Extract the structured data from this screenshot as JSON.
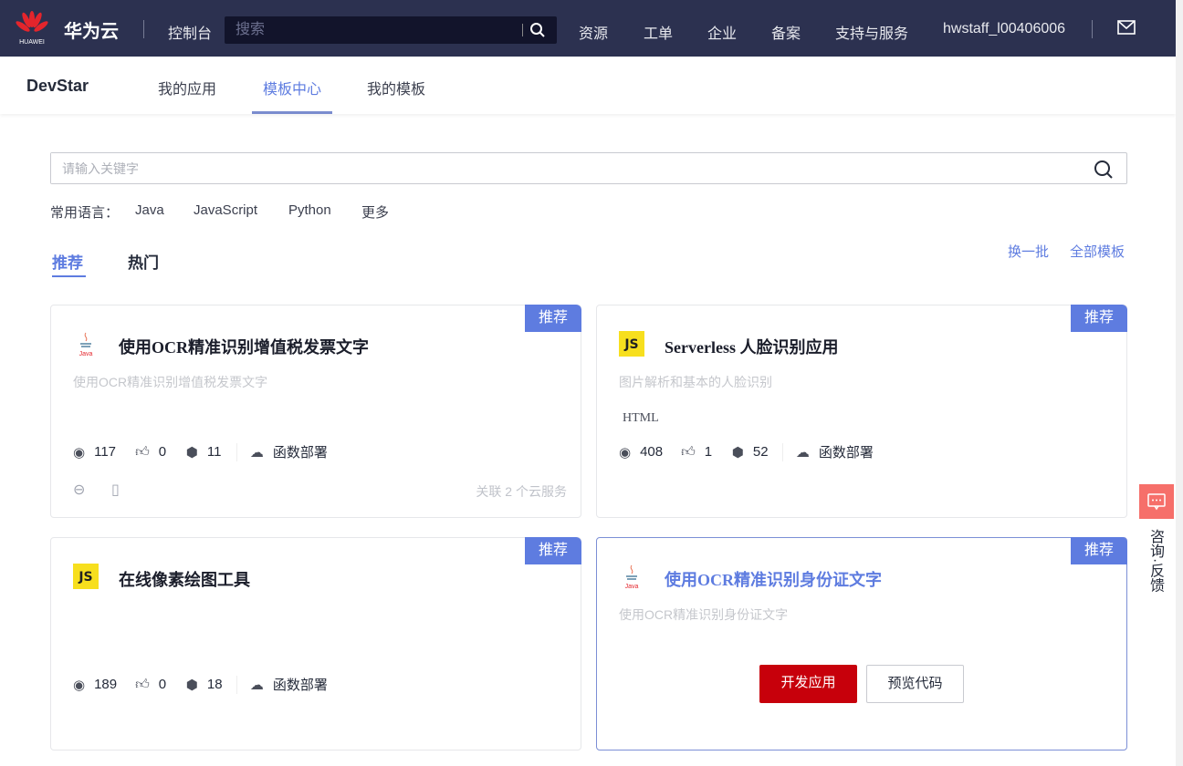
{
  "header": {
    "logo_text": "HUAWEI",
    "brand": "华为云",
    "console": "控制台",
    "search_placeholder": "搜索",
    "nav": [
      "资源",
      "工单",
      "企业",
      "备案",
      "支持与服务"
    ],
    "user": "hwstaff_l00406006"
  },
  "subnav": {
    "title": "DevStar",
    "items": [
      "我的应用",
      "模板中心",
      "我的模板"
    ],
    "active": 1
  },
  "search": {
    "placeholder": "请输入关键字"
  },
  "languages": {
    "label": "常用语言：",
    "items": [
      "Java",
      "JavaScript",
      "Python",
      "更多"
    ]
  },
  "tabs": {
    "items": [
      "推荐",
      "热门"
    ],
    "active": 0,
    "refresh": "换一批",
    "all": "全部模板"
  },
  "cards": [
    {
      "badge": "推荐",
      "lang": "Java",
      "title": "使用OCR精准识别增值税发票文字",
      "desc": "使用OCR精准识别增值税发票文字",
      "tag": "",
      "views": "117",
      "likes": "0",
      "uses": "11",
      "deploy": "函数部署",
      "services": "关联 2 个云服务"
    },
    {
      "badge": "推荐",
      "lang": "JS",
      "title": "Serverless 人脸识别应用",
      "desc": "图片解析和基本的人脸识别",
      "tag": "HTML",
      "views": "408",
      "likes": "1",
      "uses": "52",
      "deploy": "函数部署"
    },
    {
      "badge": "推荐",
      "lang": "JS",
      "title": "在线像素绘图工具",
      "desc": "",
      "tag": "",
      "views": "189",
      "likes": "0",
      "uses": "18",
      "deploy": "函数部署"
    },
    {
      "badge": "推荐",
      "lang": "Java",
      "title": "使用OCR精准识别身份证文字",
      "desc": "使用OCR精准识别身份证文字",
      "develop": "开发应用",
      "preview": "预览代码"
    }
  ],
  "feedback": {
    "label": "咨询·反馈",
    "color": "#f66f6a"
  },
  "colors": {
    "header": "#2c3150",
    "accent": "#5e7ce0",
    "primary_button": "#c7000b"
  }
}
